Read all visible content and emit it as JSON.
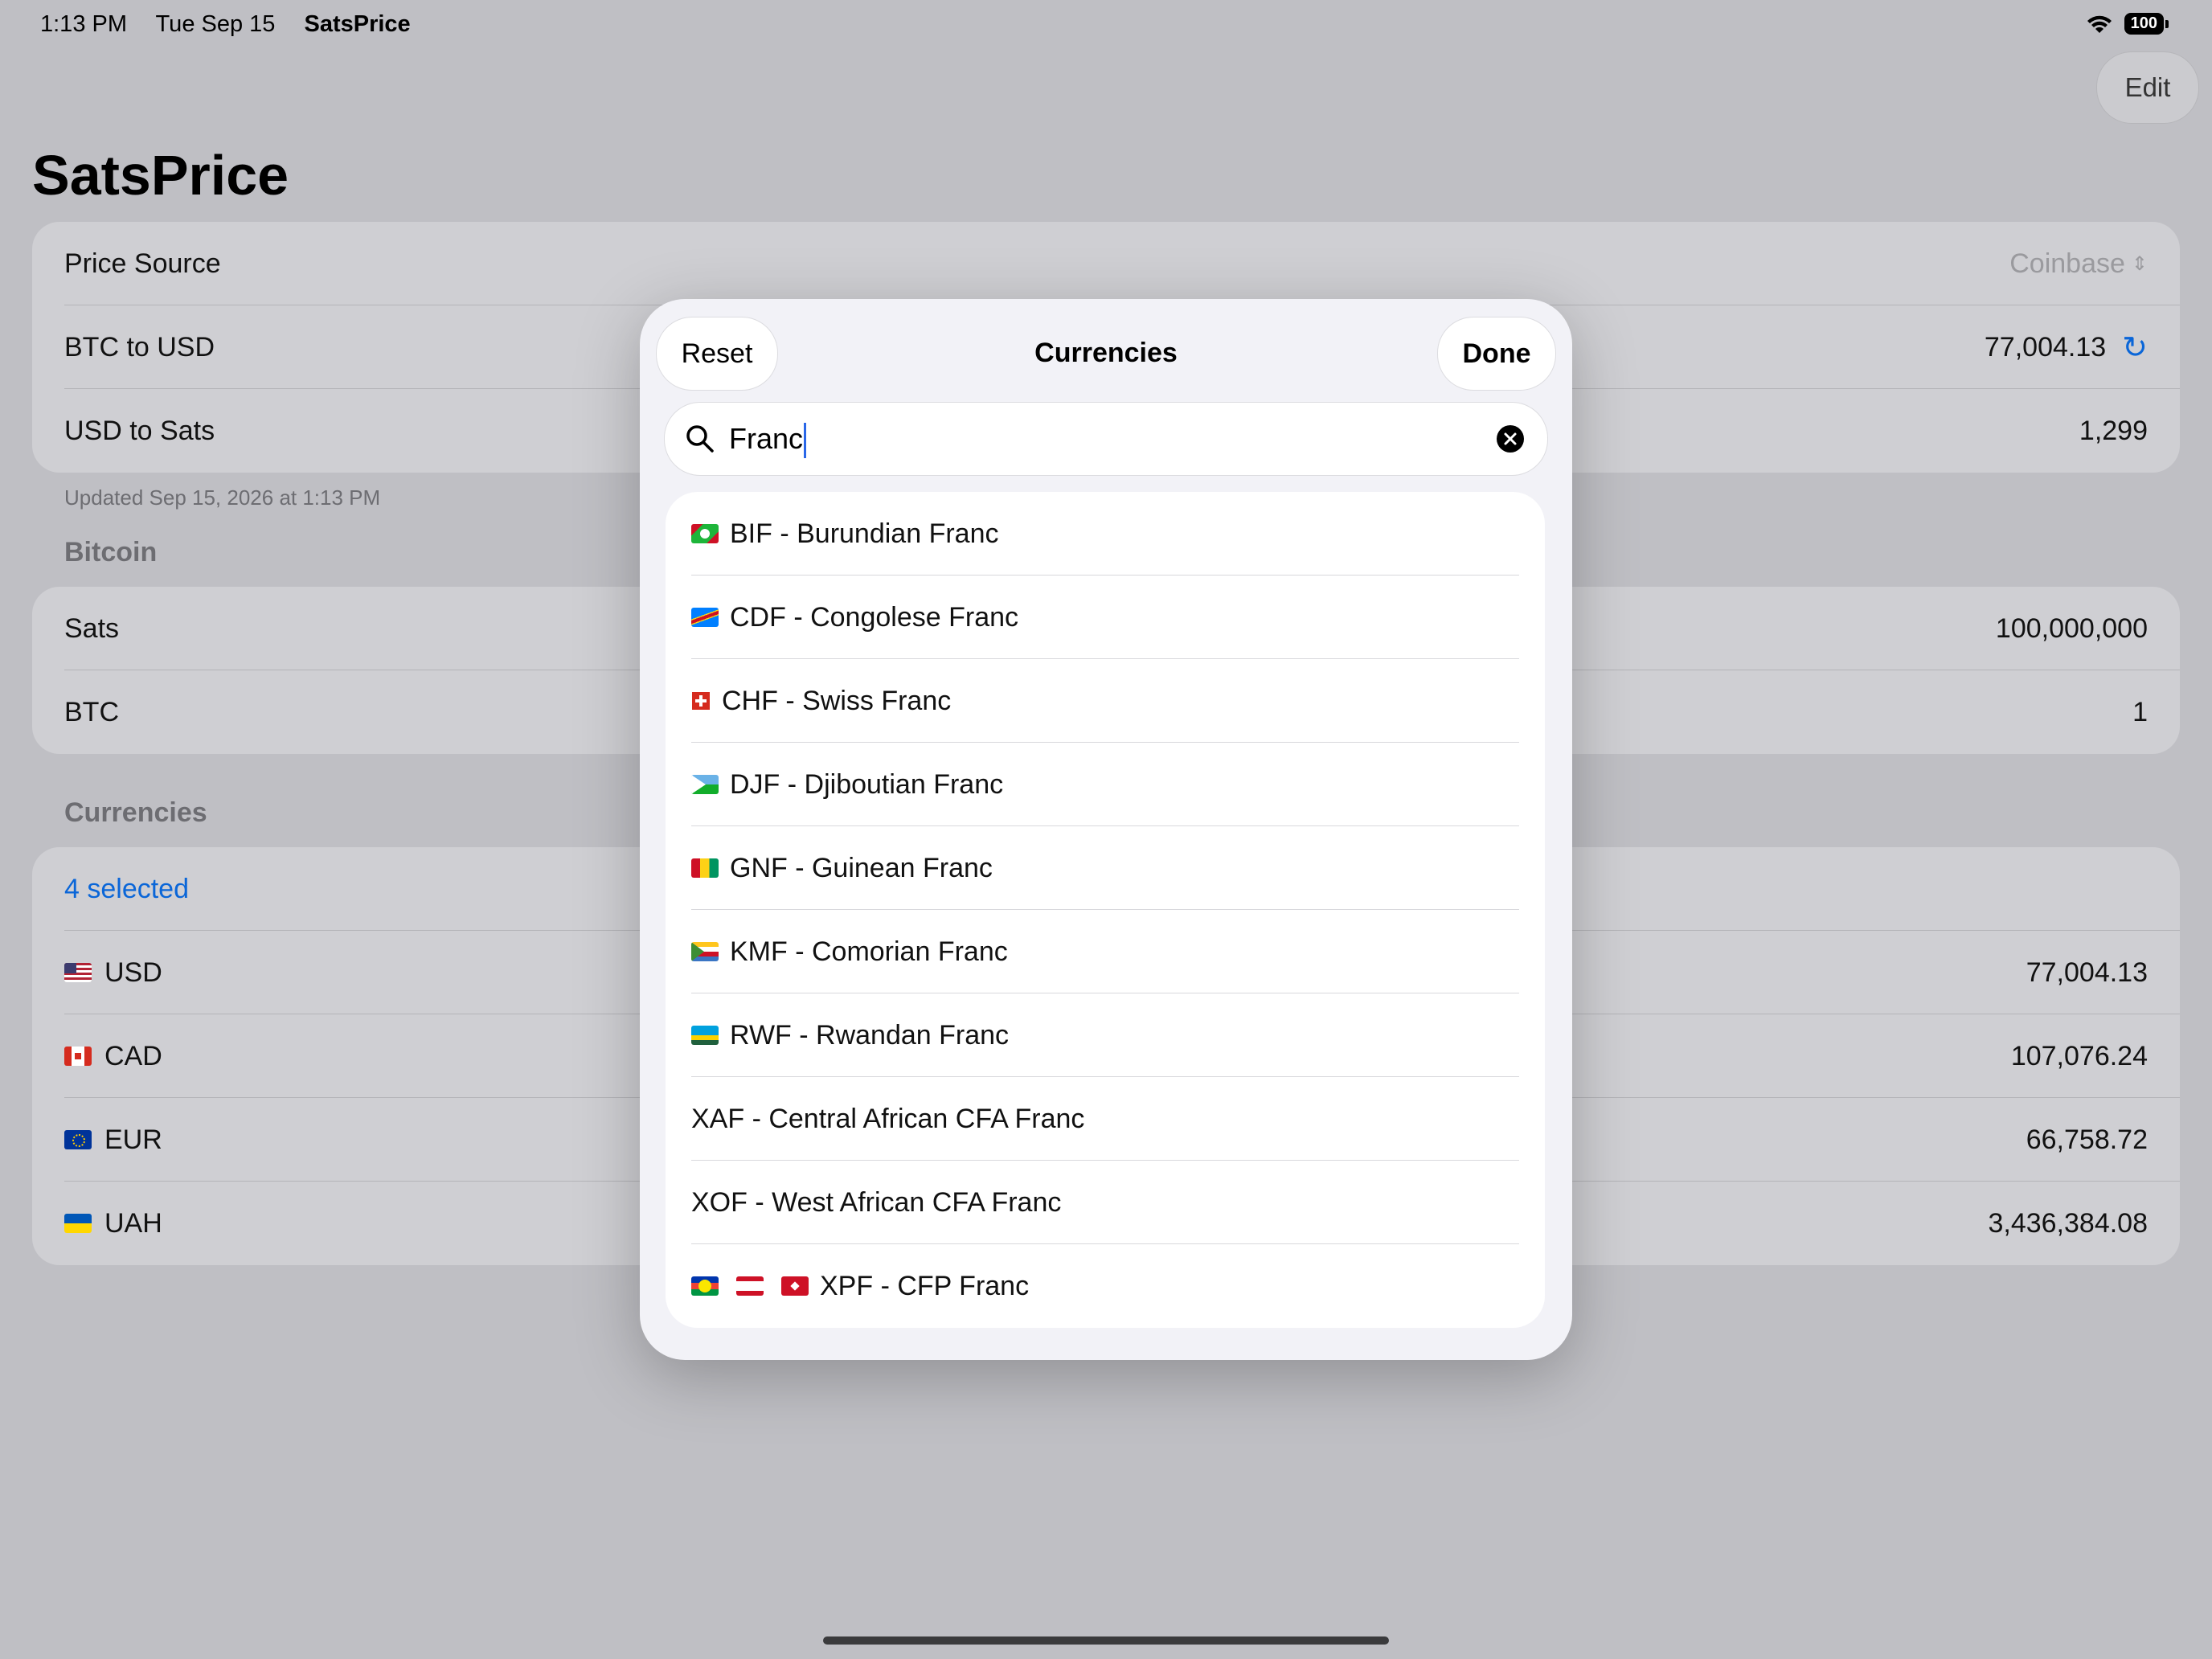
{
  "status": {
    "time": "1:13 PM",
    "date": "Tue Sep 15",
    "app": "SatsPrice",
    "battery": "100"
  },
  "nav": {
    "edit_label": "Edit",
    "title": "SatsPrice"
  },
  "price_card": {
    "source_label": "Price Source",
    "source_value": "Coinbase",
    "btc_usd_label": "BTC to USD",
    "btc_usd_value": "77,004.13",
    "usd_sats_label": "USD to Sats",
    "usd_sats_value": "1,299"
  },
  "updated": "Updated Sep 15, 2026 at 1:13 PM",
  "bitcoin": {
    "header": "Bitcoin",
    "sats_label": "Sats",
    "sats_value": "100,000,000",
    "btc_label": "BTC",
    "btc_value": "1"
  },
  "currencies": {
    "header": "Currencies",
    "selected": "4 selected",
    "rows": [
      {
        "code": "USD",
        "value": "77,004.13"
      },
      {
        "code": "CAD",
        "value": "107,076.24"
      },
      {
        "code": "EUR",
        "value": "66,758.72"
      },
      {
        "code": "UAH",
        "value": "3,436,384.08"
      }
    ]
  },
  "modal": {
    "reset_label": "Reset",
    "title": "Currencies",
    "done_label": "Done",
    "search_value": "Franc",
    "results": [
      "BIF - Burundian Franc",
      "CDF - Congolese Franc",
      "CHF - Swiss Franc",
      "DJF - Djiboutian Franc",
      "GNF - Guinean Franc",
      "KMF - Comorian Franc",
      "RWF - Rwandan Franc",
      "XAF - Central African CFA Franc",
      "XOF - West African CFA Franc",
      "XPF - CFP Franc"
    ]
  },
  "colors": {
    "accent": "#0a66d8",
    "background": "#bfbfc4",
    "modal": "#f2f2f7"
  }
}
